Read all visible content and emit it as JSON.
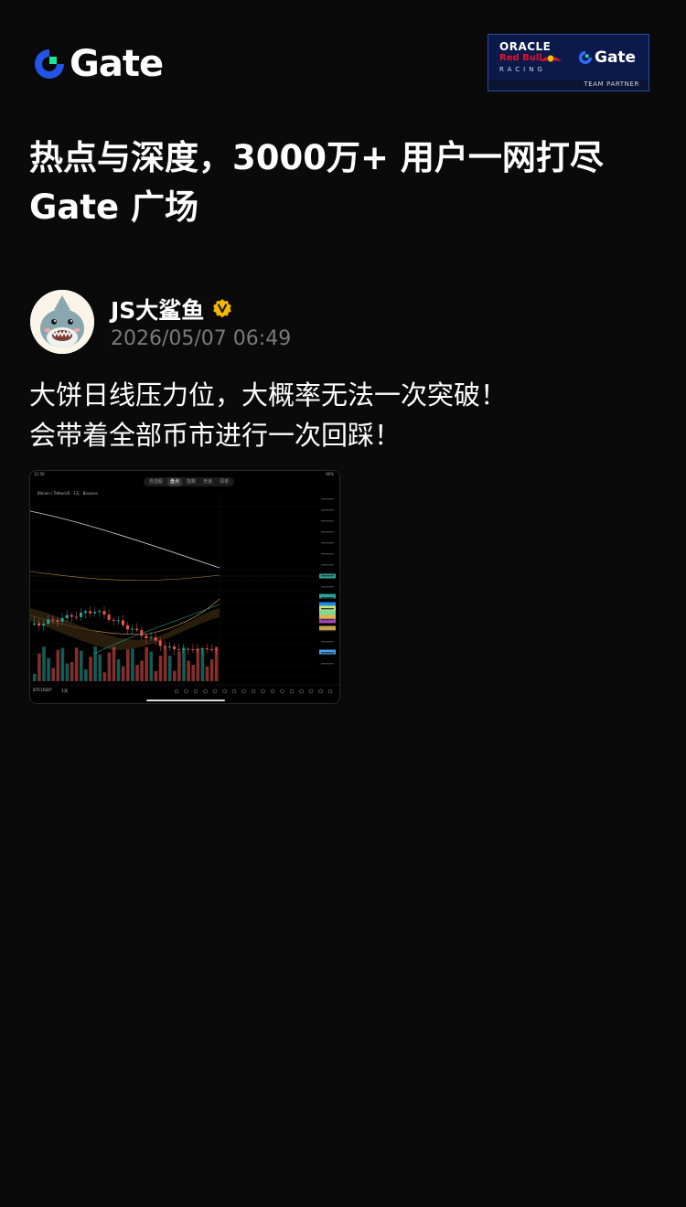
{
  "brand": {
    "logo_text": "Gate",
    "logo_icon": "gate-logo-icon"
  },
  "partner_badge": {
    "oracle": "ORACLE",
    "redbull": "Red Bull",
    "racing": "RACING",
    "gate": "Gate",
    "caption": "TEAM PARTNER"
  },
  "headline": {
    "line1": "热点与深度，3000万+ 用户一网打尽",
    "line2": "Gate 广场"
  },
  "post": {
    "author": "JS大鲨鱼",
    "verified_icon": "verified-badge-icon",
    "timestamp": "2026/05/07 06:49",
    "body_line1": "大饼日线压力位，大概率无法一次突破！",
    "body_line2": "会带着全部币市进行一次回踩！"
  },
  "screenshot": {
    "tabs": [
      "自选股",
      "盘点",
      "指数",
      "无道",
      "清单"
    ],
    "active_tab": 1,
    "symbol_line": "Bitcoin / TetherUS · 1天 · Binance",
    "pair": "BTCUSDT",
    "timeframe": "1天",
    "colors": {
      "up": "#26a69a",
      "down": "#ef5350"
    }
  }
}
